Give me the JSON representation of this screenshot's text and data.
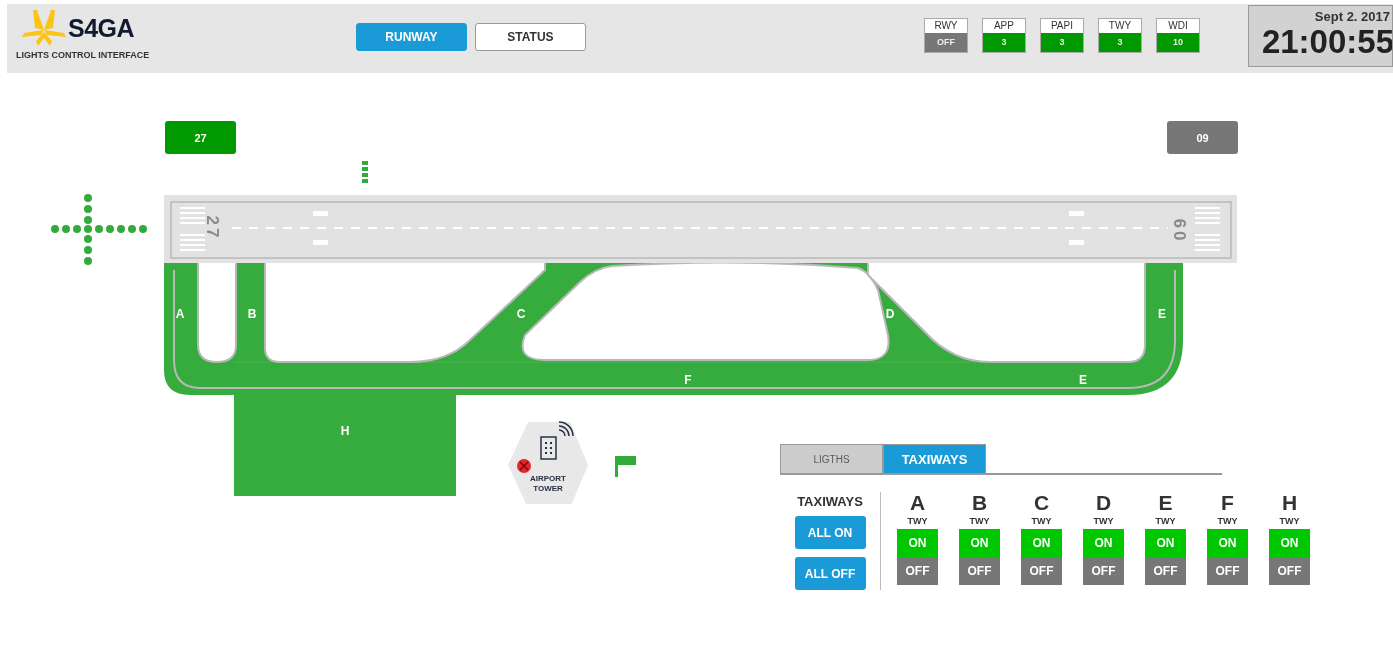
{
  "header": {
    "brand": "S4GA",
    "subtitle": "LIGHTS CONTROL INTERFACE",
    "nav": [
      {
        "label": "RUNWAY",
        "selected": true
      },
      {
        "label": "STATUS",
        "selected": false
      }
    ],
    "indicators": [
      {
        "label": "RWY",
        "value": "OFF",
        "on": false
      },
      {
        "label": "APP",
        "value": "3",
        "on": true
      },
      {
        "label": "PAPI",
        "value": "3",
        "on": true
      },
      {
        "label": "TWY",
        "value": "3",
        "on": true
      },
      {
        "label": "WDI",
        "value": "10",
        "on": true
      }
    ],
    "clock": {
      "date": "Sept 2. 2017",
      "time": "21:00:55"
    }
  },
  "map": {
    "runway_ends": [
      {
        "label": "27",
        "on": true
      },
      {
        "label": "09",
        "on": false
      }
    ],
    "runway_numbers": [
      "27",
      "09"
    ],
    "taxiway_labels": [
      "A",
      "B",
      "C",
      "D",
      "E",
      "F",
      "E",
      "H"
    ],
    "tower": {
      "label": "AIRPORT TOWER",
      "alarm": true
    }
  },
  "panel": {
    "tabs": [
      {
        "label": "LIGTHS",
        "selected": false
      },
      {
        "label": "TAXIWAYS",
        "selected": true
      }
    ],
    "group_title": "TAXIWAYS",
    "group_buttons": [
      "ALL ON",
      "ALL OFF"
    ],
    "taxiways": [
      {
        "name": "A",
        "sub": "TWY",
        "on_text": "ON",
        "off_text": "OFF",
        "on": true
      },
      {
        "name": "B",
        "sub": "TWY",
        "on_text": "ON",
        "off_text": "OFF",
        "on": true
      },
      {
        "name": "C",
        "sub": "TWY",
        "on_text": "ON",
        "off_text": "OFF",
        "on": true
      },
      {
        "name": "D",
        "sub": "TWY",
        "on_text": "ON",
        "off_text": "OFF",
        "on": true
      },
      {
        "name": "E",
        "sub": "TWY",
        "on_text": "ON",
        "off_text": "OFF",
        "on": true
      },
      {
        "name": "F",
        "sub": "TWY",
        "on_text": "ON",
        "off_text": "OFF",
        "on": true
      },
      {
        "name": "H",
        "sub": "TWY",
        "on_text": "ON",
        "off_text": "OFF",
        "on": true
      }
    ]
  }
}
